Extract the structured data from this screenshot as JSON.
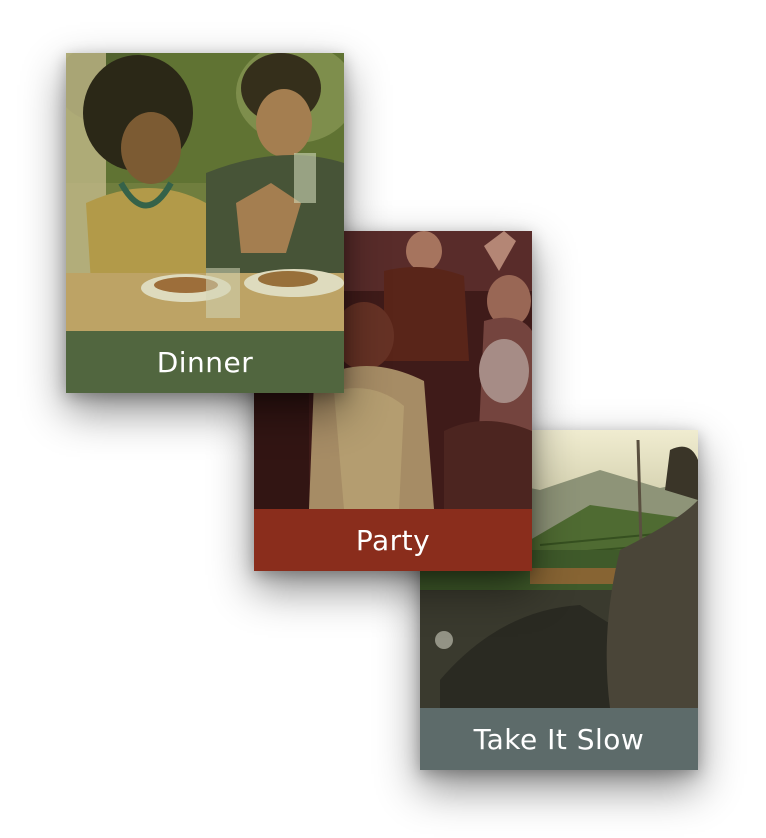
{
  "cards": [
    {
      "label": "Dinner",
      "color": "#51663f"
    },
    {
      "label": "Party",
      "color": "#8a2d1c"
    },
    {
      "label": "Take It Slow",
      "color": "#5d6b6a"
    }
  ]
}
